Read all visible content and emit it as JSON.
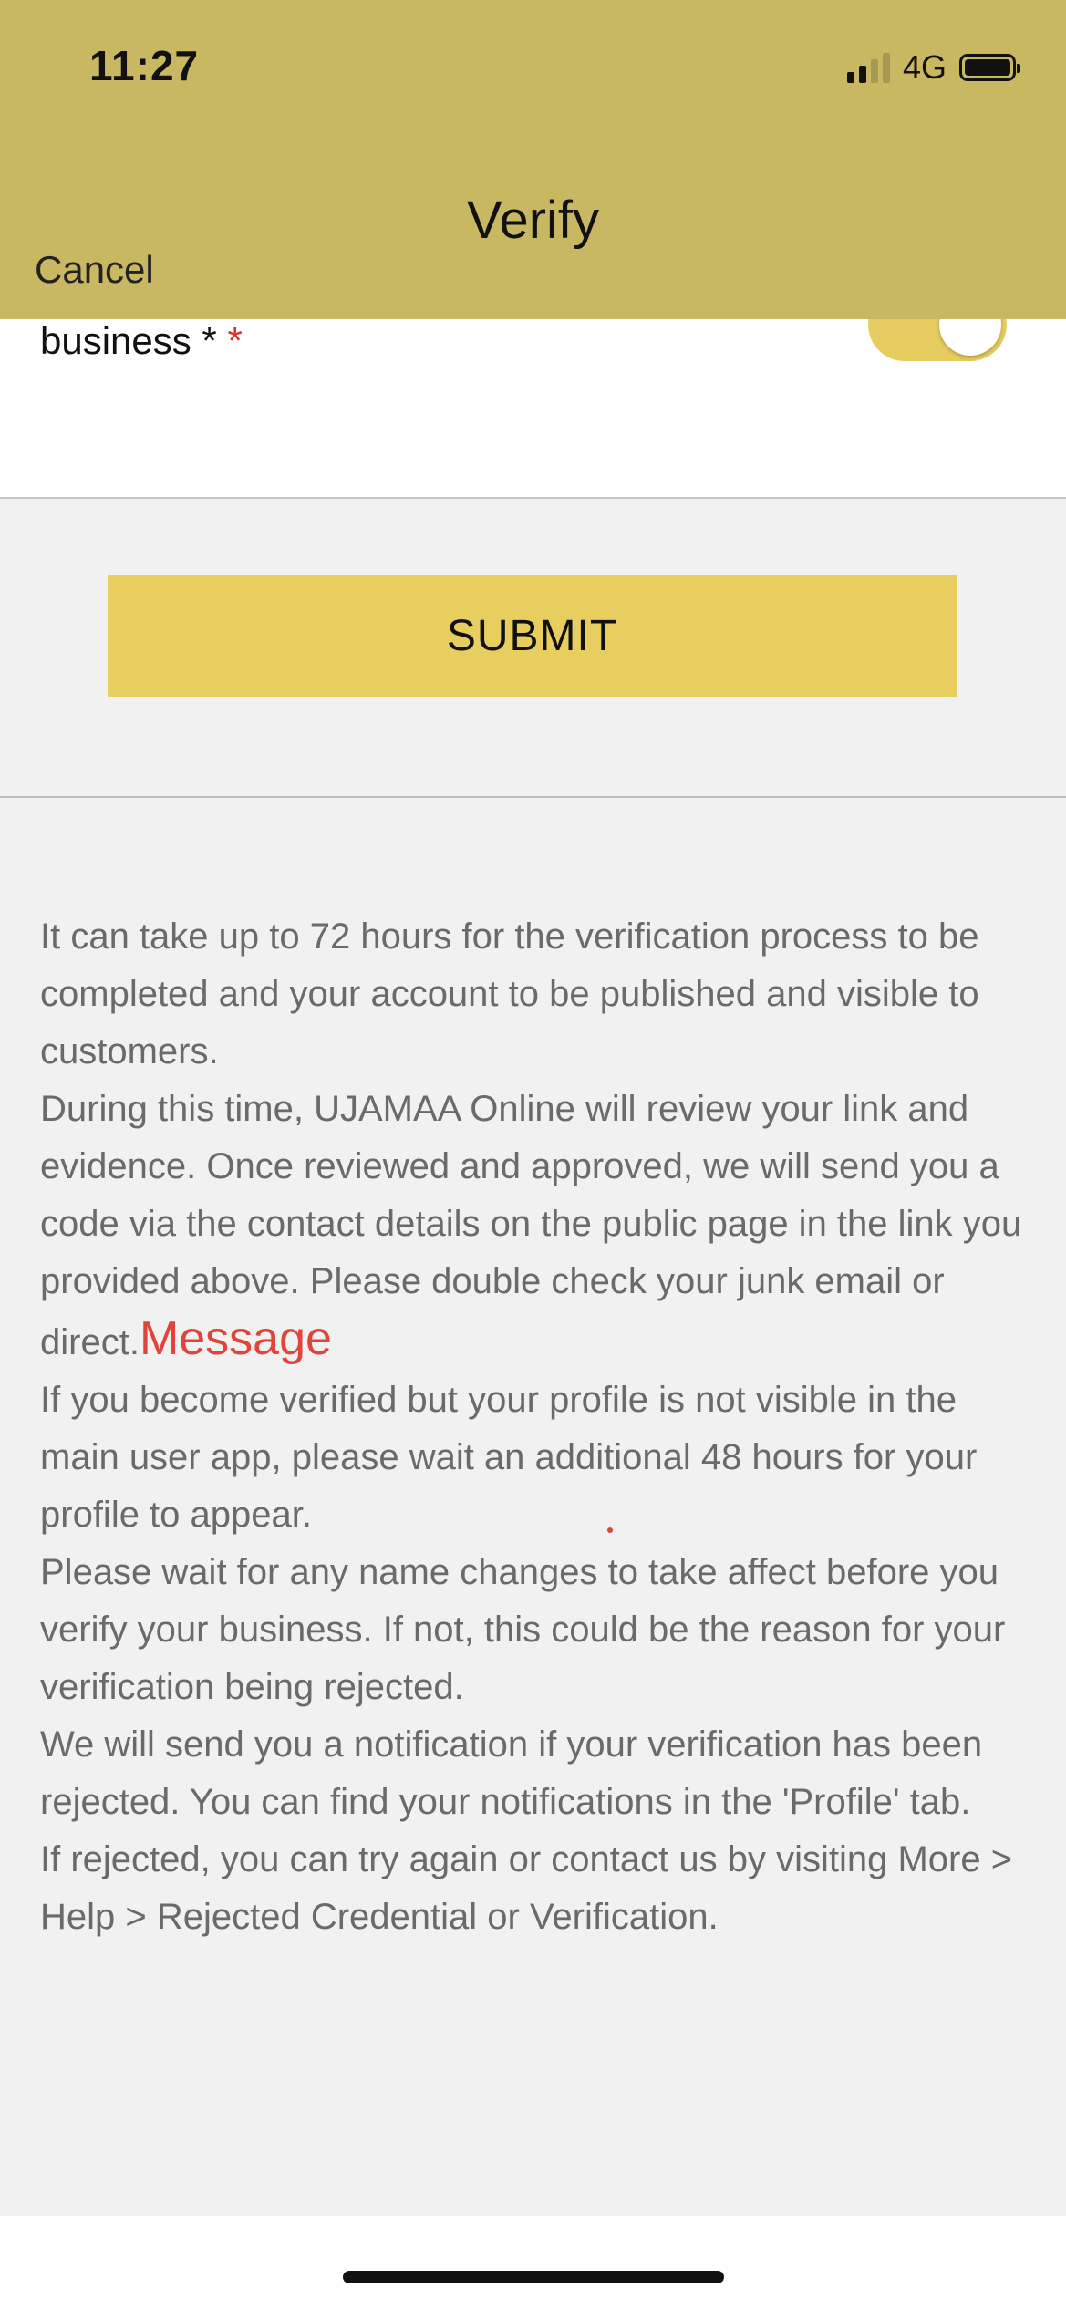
{
  "status_bar": {
    "time": "11:27",
    "network": "4G",
    "signal_bars_active": 2,
    "signal_bars_total": 4
  },
  "header": {
    "title": "Verify",
    "cancel_label": "Cancel",
    "background_color": "#c9b862"
  },
  "form": {
    "field_label": "business *",
    "required_marker": "*",
    "toggle_on": true
  },
  "submit": {
    "label": "SUBMIT",
    "color": "#e8ce5e"
  },
  "info": {
    "paragraphs": [
      "It can take up to 72 hours for the verification process to be completed and your account to be published and visible to customers.",
      "During this time, UJAMAA Online will review your link and evidence. Once reviewed and approved, we will send you a code via the contact details on the public page in the link you provided above. Please double check your junk email or direct.",
      "If you become verified but your profile is not visible in the main user app, please wait an additional 48 hours for your profile to appear.",
      "Please wait for any name changes to take affect before you verify your business. If not, this could be the reason for your verification being rejected.",
      "We will send you a notification if your verification has been rejected. You can find your notifications in the 'Profile' tab.",
      "If rejected, you can try again or contact us by visiting More > Help > Rejected Credential or Verification."
    ],
    "annotation": "Message"
  }
}
